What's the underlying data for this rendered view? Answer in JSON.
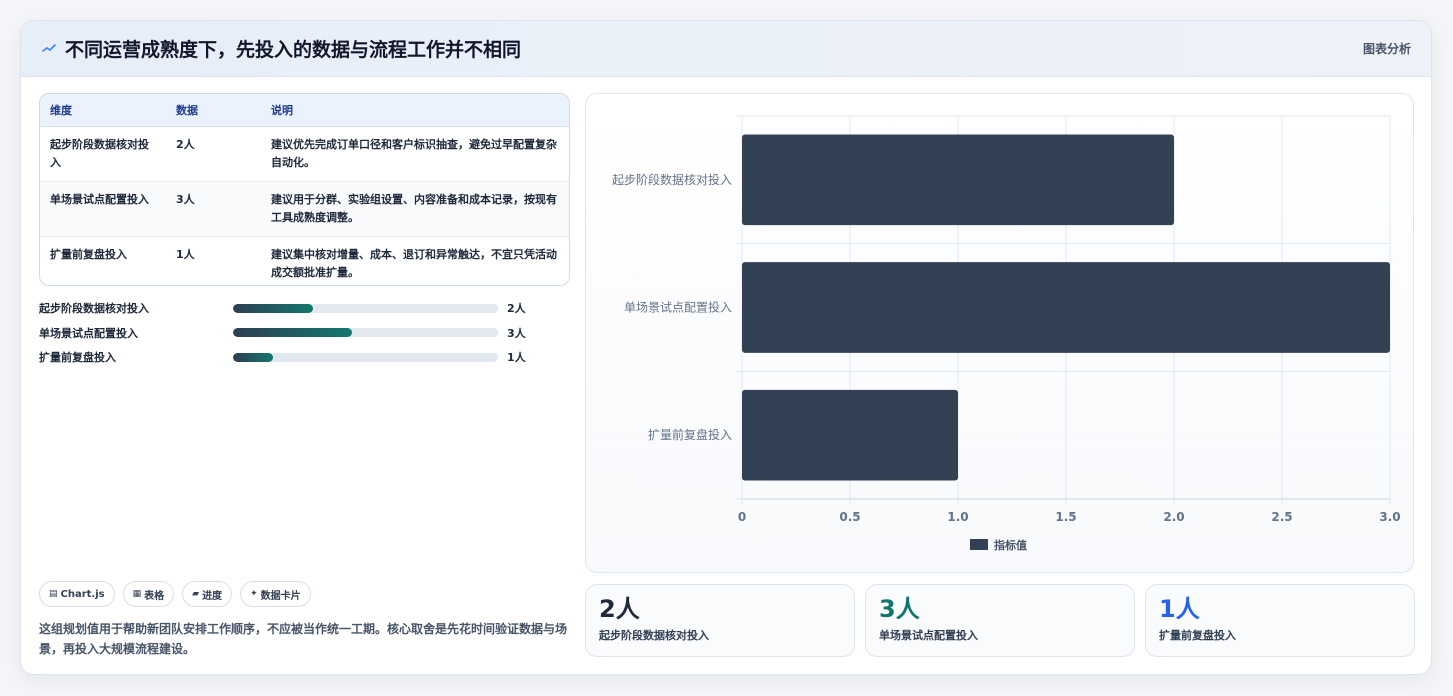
{
  "header": {
    "title": "不同运营成熟度下，先投入的数据与流程工作并不相同",
    "tag": "图表分析",
    "icon": "sparkle-icon"
  },
  "table": {
    "columns": [
      "维度",
      "数据",
      "说明"
    ],
    "rows": [
      {
        "dim": "起步阶段数据核对投入",
        "value": "2人",
        "desc": "建议优先完成订单口径和客户标识抽查，避免过早配置复杂自动化。"
      },
      {
        "dim": "单场景试点配置投入",
        "value": "3人",
        "desc": "建议用于分群、实验组设置、内容准备和成本记录，按现有工具成熟度调整。"
      },
      {
        "dim": "扩量前复盘投入",
        "value": "1人",
        "desc": "建议集中核对增量、成本、退订和异常触达，不宜只凭活动成交额批准扩量。"
      }
    ]
  },
  "progress": [
    {
      "label": "起步阶段数据核对投入",
      "value_text": "2人",
      "fraction": 0.3
    },
    {
      "label": "单场景试点配置投入",
      "value_text": "3人",
      "fraction": 0.45
    },
    {
      "label": "扩量前复盘投入",
      "value_text": "1人",
      "fraction": 0.15
    }
  ],
  "chips": [
    {
      "icon": "chart-icon",
      "glyph": "▤",
      "label": "Chart.js"
    },
    {
      "icon": "table-icon",
      "glyph": "▦",
      "label": "表格"
    },
    {
      "icon": "progress-icon",
      "glyph": "▰",
      "label": "进度"
    },
    {
      "icon": "card-icon",
      "glyph": "✦",
      "label": "数据卡片"
    }
  ],
  "note": "这组规划值用于帮助新团队安排工作顺序，不应被当作统一工期。核心取舍是先花时间验证数据与场景，再投入大规模流程建设。",
  "chart_data": {
    "type": "bar",
    "orientation": "horizontal",
    "categories": [
      "起步阶段数据核对投入",
      "单场景试点配置投入",
      "扩量前复盘投入"
    ],
    "series": [
      {
        "name": "指标值",
        "values": [
          2,
          3,
          1
        ]
      }
    ],
    "xlim": [
      0,
      3.0
    ],
    "x_ticks": [
      "0",
      "0.5",
      "1.0",
      "1.5",
      "2.0",
      "2.5",
      "3.0"
    ],
    "grid": true,
    "legend": "bottom",
    "colors": {
      "bar": "#334155",
      "grid": "#e2e8f0",
      "tick": "#64748b"
    }
  },
  "kpis": [
    {
      "value": "2人",
      "label": "起步阶段数据核对投入",
      "color": "#1e293b"
    },
    {
      "value": "3人",
      "label": "单场景试点配置投入",
      "color": "#0f766e"
    },
    {
      "value": "1人",
      "label": "扩量前复盘投入",
      "color": "#2563eb"
    }
  ]
}
